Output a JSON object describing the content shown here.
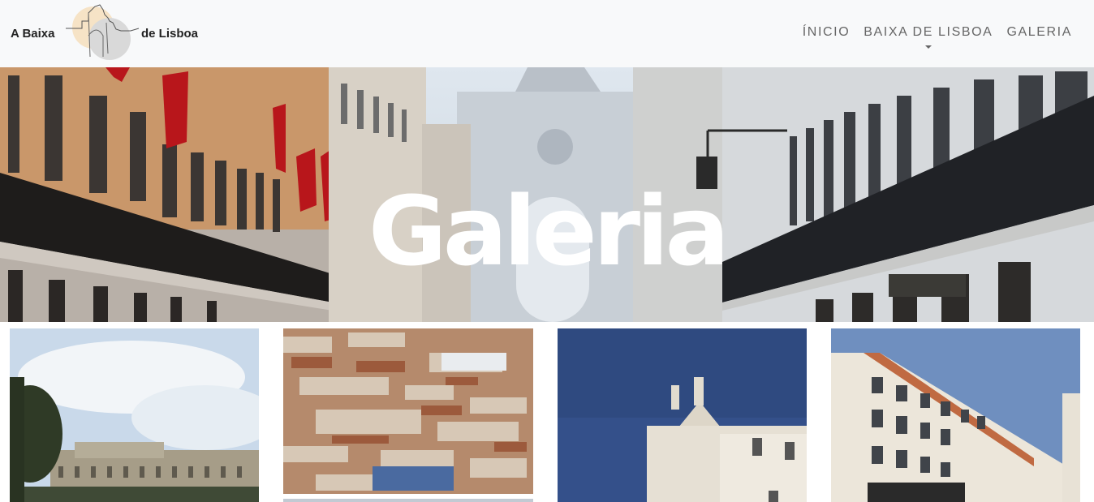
{
  "brand": {
    "left_text": "A Baixa",
    "right_text": "de Lisboa"
  },
  "nav": {
    "items": [
      {
        "label": "ÍNICIO",
        "dropdown": false
      },
      {
        "label": "BAIXA DE LISBOA",
        "dropdown": true
      },
      {
        "label": "GALERIA",
        "dropdown": false
      }
    ]
  },
  "hero": {
    "title": "Galeria"
  },
  "gallery": {
    "items": [
      {
        "subject": "praca-do-comercio-sky"
      },
      {
        "subject": "baixa-aerial-view"
      },
      {
        "subject": "church-facade"
      },
      {
        "subject": "corner-building"
      }
    ]
  },
  "colors": {
    "navbar_bg": "#f8f9fa",
    "nav_text": "#666666",
    "brand_text": "#222222",
    "hero_title": "#ffffff"
  }
}
